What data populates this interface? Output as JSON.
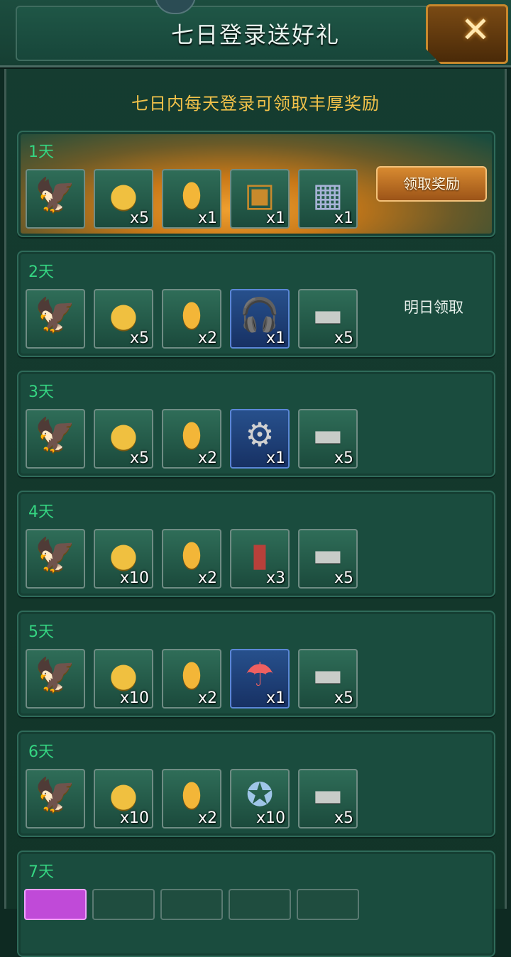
{
  "header": {
    "title": "七日登录送好礼",
    "close_icon": "close-x-icon"
  },
  "subtitle": "七日内每天登录可领取丰厚奖励",
  "days": [
    {
      "label": "1天",
      "status": "领取奖励",
      "claimable": true,
      "items": [
        {
          "icon": "eagle-insignia-icon",
          "qty": ""
        },
        {
          "icon": "gold-coins-icon",
          "qty": "x5"
        },
        {
          "icon": "gold-tag-icon",
          "qty": "x1"
        },
        {
          "icon": "gold-chest-icon",
          "qty": "x1"
        },
        {
          "icon": "silver-box-icon",
          "qty": "x1"
        }
      ]
    },
    {
      "label": "2天",
      "status": "明日领取",
      "claimable": false,
      "items": [
        {
          "icon": "eagle-insignia-icon",
          "qty": ""
        },
        {
          "icon": "gold-coins-icon",
          "qty": "x5"
        },
        {
          "icon": "gold-tag-icon",
          "qty": "x2"
        },
        {
          "icon": "headset-icon",
          "qty": "x1"
        },
        {
          "icon": "tank-icon",
          "qty": "x5"
        }
      ]
    },
    {
      "label": "3天",
      "status": "",
      "claimable": false,
      "items": [
        {
          "icon": "eagle-insignia-icon",
          "qty": ""
        },
        {
          "icon": "gold-coins-icon",
          "qty": "x5"
        },
        {
          "icon": "gold-tag-icon",
          "qty": "x2"
        },
        {
          "icon": "gear-oil-icon",
          "qty": "x1"
        },
        {
          "icon": "tank-icon",
          "qty": "x5"
        }
      ]
    },
    {
      "label": "4天",
      "status": "",
      "claimable": false,
      "items": [
        {
          "icon": "eagle-insignia-icon",
          "qty": ""
        },
        {
          "icon": "gold-coins-icon",
          "qty": "x10"
        },
        {
          "icon": "gold-tag-icon",
          "qty": "x2"
        },
        {
          "icon": "red-book-icon",
          "qty": "x3"
        },
        {
          "icon": "artillery-icon",
          "qty": "x5"
        }
      ]
    },
    {
      "label": "5天",
      "status": "",
      "claimable": false,
      "items": [
        {
          "icon": "eagle-insignia-icon",
          "qty": ""
        },
        {
          "icon": "gold-coins-icon",
          "qty": "x10"
        },
        {
          "icon": "gold-tag-icon",
          "qty": "x2"
        },
        {
          "icon": "parachute-crate-icon",
          "qty": "x1"
        },
        {
          "icon": "rocket-truck-icon",
          "qty": "x5"
        }
      ]
    },
    {
      "label": "6天",
      "status": "",
      "claimable": false,
      "items": [
        {
          "icon": "eagle-insignia-icon",
          "qty": ""
        },
        {
          "icon": "gold-coins-icon",
          "qty": "x10"
        },
        {
          "icon": "gold-tag-icon",
          "qty": "x2"
        },
        {
          "icon": "skull-medal-icon",
          "qty": "x10"
        },
        {
          "icon": "tank-icon",
          "qty": "x5"
        }
      ]
    },
    {
      "label": "7天",
      "status": "",
      "claimable": false,
      "items": []
    }
  ],
  "colors": {
    "accent_gold": "#f2c24a",
    "day_label_green": "#35d682",
    "panel_bg": "#1a4c3e"
  }
}
